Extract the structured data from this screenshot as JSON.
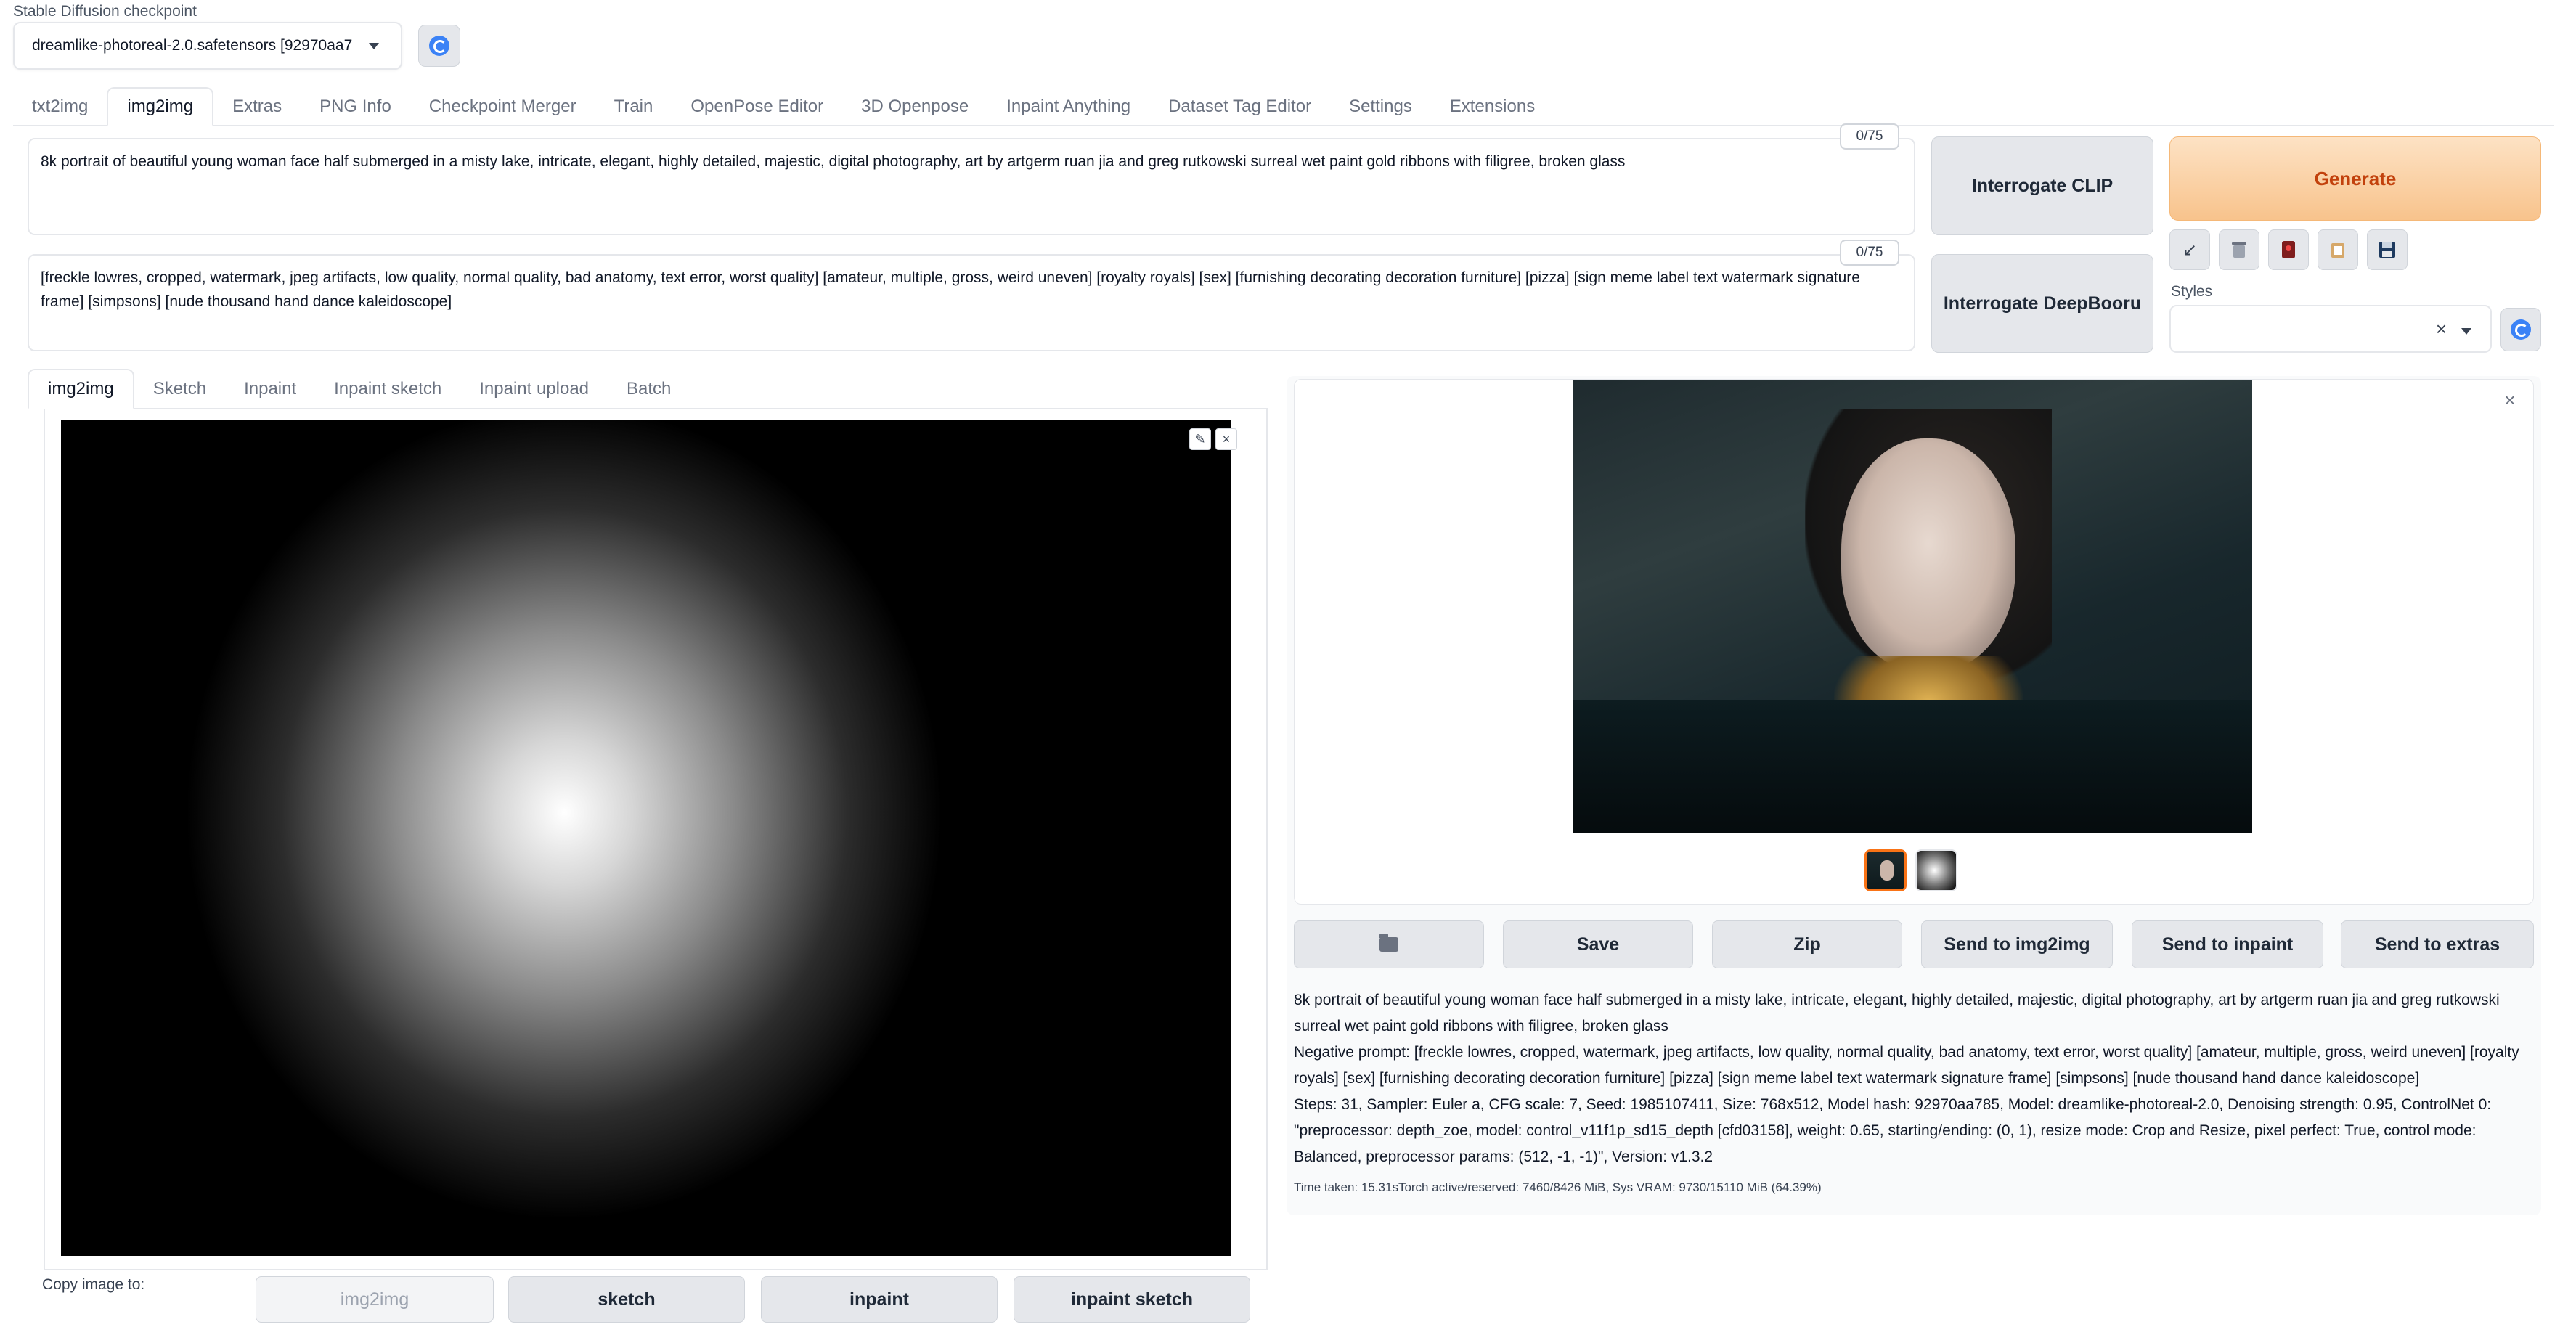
{
  "checkpoint": {
    "label": "Stable Diffusion checkpoint",
    "value": "dreamlike-photoreal-2.0.safetensors [92970aa7"
  },
  "top_tabs": [
    "txt2img",
    "img2img",
    "Extras",
    "PNG Info",
    "Checkpoint Merger",
    "Train",
    "OpenPose Editor",
    "3D Openpose",
    "Inpaint Anything",
    "Dataset Tag Editor",
    "Settings",
    "Extensions"
  ],
  "prompt": {
    "positive": "8k portrait of beautiful young woman face half submerged in a misty lake, intricate, elegant, highly detailed, majestic, digital photography, art by artgerm ruan jia and greg rutkowski surreal wet paint gold ribbons with filigree, broken glass",
    "negative": "[freckle lowres, cropped, watermark, jpeg artifacts, low quality, normal quality, bad anatomy, text error, worst quality] [amateur, multiple, gross, weird uneven] [royalty royals] [sex] [furnishing decorating decoration furniture] [pizza] [sign meme label text watermark signature frame] [simpsons] [nude thousand hand dance kaleidoscope]",
    "pos_counter": "0/75",
    "neg_counter": "0/75"
  },
  "buttons": {
    "interrogate_clip": "Interrogate CLIP",
    "interrogate_deepbooru": "Interrogate DeepBooru",
    "generate": "Generate"
  },
  "styles": {
    "label": "Styles",
    "value": ""
  },
  "sub_tabs": [
    "img2img",
    "Sketch",
    "Inpaint",
    "Inpaint sketch",
    "Inpaint upload",
    "Batch"
  ],
  "copy_image": {
    "label": "Copy image to:",
    "buttons": [
      "img2img",
      "sketch",
      "inpaint",
      "inpaint sketch"
    ]
  },
  "output_actions": {
    "save": "Save",
    "zip": "Zip",
    "send_img2img": "Send to img2img",
    "send_inpaint": "Send to inpaint",
    "send_extras": "Send to extras"
  },
  "info": {
    "prompt": "8k portrait of beautiful young woman face half submerged in a misty lake, intricate, elegant, highly detailed, majestic, digital photography, art by artgerm ruan jia and greg rutkowski surreal wet paint gold ribbons with filigree, broken glass",
    "negative": "Negative prompt: [freckle lowres, cropped, watermark, jpeg artifacts, low quality, normal quality, bad anatomy, text error, worst quality] [amateur, multiple, gross, weird uneven] [royalty royals] [sex] [furnishing decorating decoration furniture] [pizza] [sign meme label text watermark signature frame] [simpsons] [nude thousand hand dance kaleidoscope]",
    "params": "Steps: 31, Sampler: Euler a, CFG scale: 7, Seed: 1985107411, Size: 768x512, Model hash: 92970aa785, Model: dreamlike-photoreal-2.0, Denoising strength: 0.95, ControlNet 0: \"preprocessor: depth_zoe, model: control_v11f1p_sd15_depth [cfd03158], weight: 0.65, starting/ending: (0, 1), resize mode: Crop and Resize, pixel perfect: True, control mode: Balanced, preprocessor params: (512, -1, -1)\", Version: v1.3.2",
    "time": "Time taken: 15.31sTorch active/reserved: 7460/8426 MiB, Sys VRAM: 9730/15110 MiB (64.39%)"
  },
  "colors": {
    "accent": "#f97316",
    "generate_bg": "#f8c38c",
    "generate_text": "#c2410c",
    "button_bg": "#e5e7eb"
  }
}
